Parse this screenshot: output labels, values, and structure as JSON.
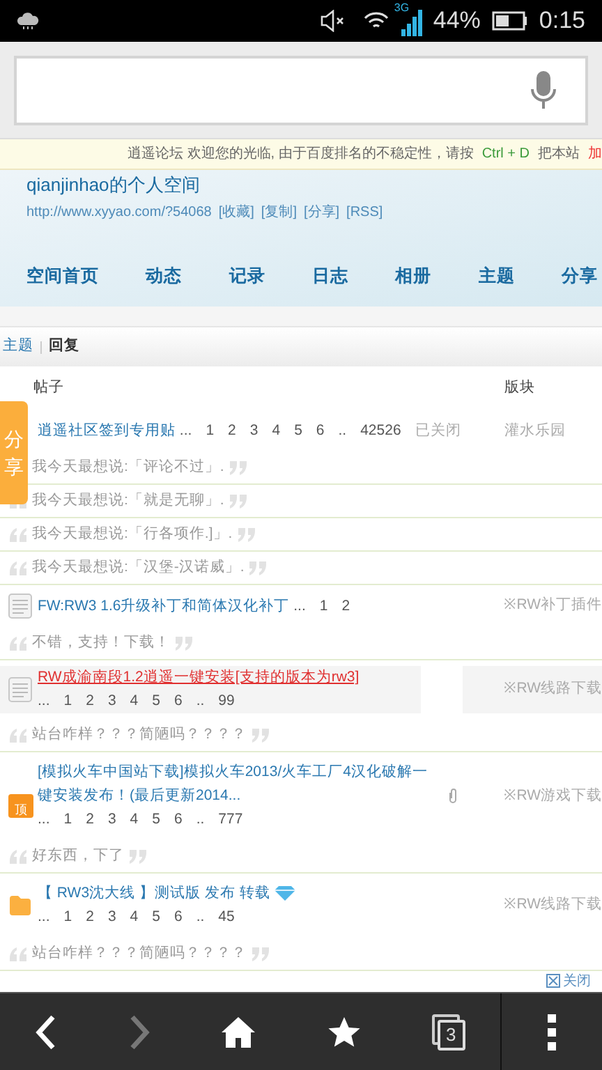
{
  "status_bar": {
    "network": "3G",
    "battery": "44%",
    "time": "0:15"
  },
  "notice": [
    {
      "kind": "plain",
      "text": "逍遥论坛  欢迎您的光临, 由于百度排名的不稳定性，请按"
    },
    {
      "kind": "key",
      "text": "Ctrl + D"
    },
    {
      "kind": "plain",
      "text": "把本站"
    },
    {
      "kind": "alert",
      "text": "加"
    }
  ],
  "space": {
    "title": "qianjinhao的个人空间",
    "url": "http://www.xyyao.com/?54068",
    "links": [
      "[收藏]",
      "[复制]",
      "[分享]",
      "[RSS]"
    ]
  },
  "nav": [
    "空间首页",
    "动态",
    "记录",
    "日志",
    "相册",
    "主题",
    "分享"
  ],
  "tabs": [
    {
      "label": "主题",
      "selected": false
    },
    {
      "label": "回复",
      "selected": true
    }
  ],
  "table": {
    "columns": [
      "帖子",
      "版块"
    ],
    "threads": [
      {
        "kind": "plain",
        "title": "逍遥社区签到专用贴",
        "highlighted": false,
        "pages": [
          "...",
          "1",
          "2",
          "3",
          "4",
          "5",
          "6",
          "..",
          "42526"
        ],
        "status": "已关闭",
        "forum": "灌水乐园",
        "replies": [
          "我今天最想说:「评论不过」.",
          "我今天最想说:「就是无聊」.",
          "我今天最想说:「行各项作.]」.",
          "我今天最想说:「汉堡-汉诺威」."
        ]
      },
      {
        "kind": "document",
        "title": "FW:RW3  1.6升级补丁和简体汉化补丁",
        "highlighted": false,
        "pages": [
          "...",
          "1",
          "2"
        ],
        "forum": "※RW补丁插件",
        "replies": [
          "不错，支持！下载！"
        ]
      },
      {
        "kind": "document",
        "title": "RW成渝南段1.2逍遥一键安装[支持的版本为rw3]",
        "highlighted": true,
        "pages": [
          "...",
          "1",
          "2",
          "3",
          "4",
          "5",
          "6",
          "..",
          "99"
        ],
        "forum": "※RW线路下载",
        "replies": [
          "站台咋样？？？简陋吗？？？？"
        ]
      },
      {
        "kind": "pinned",
        "pin_label": "顶",
        "title": "[模拟火车中国站下载]模拟火车2013/火车工厂4汉化破解一键安装发布！(最后更新2014...",
        "attachment": true,
        "highlighted": false,
        "pages": [
          "...",
          "1",
          "2",
          "3",
          "4",
          "5",
          "6",
          "..",
          "777"
        ],
        "forum": "※RW游戏下载",
        "replies": [
          "好东西，下了"
        ]
      },
      {
        "kind": "folder",
        "title": "【 RW3沈大线 】测试版  发布  转载",
        "diamond": true,
        "highlighted": false,
        "pages": [
          "...",
          "1",
          "2",
          "3",
          "4",
          "5",
          "6",
          "..",
          "45"
        ],
        "forum": "※RW线路下载",
        "replies": [
          "站台咋样？？？简陋吗？？？？"
        ]
      }
    ]
  },
  "share_tab": "分享",
  "close_link": "关闭",
  "browser_nav": {
    "forward_disabled": true,
    "tab_count": "3"
  }
}
